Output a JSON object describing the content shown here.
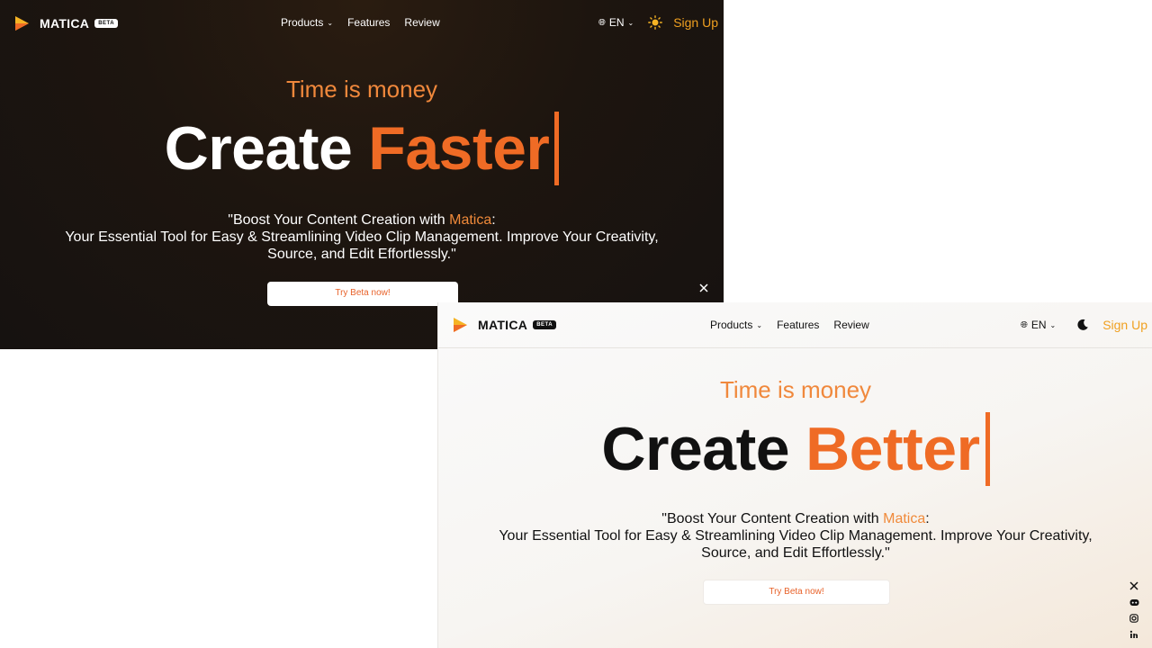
{
  "brand": {
    "name": "MATICA",
    "badge": "BETA"
  },
  "nav": {
    "products": "Products",
    "features": "Features",
    "review": "Review",
    "language": "EN",
    "signup": "Sign Up"
  },
  "hero": {
    "tagline": "Time is money",
    "headline_prefix": "Create",
    "description_open": "\"Boost Your Content Creation with ",
    "description_brand": "Matica",
    "description_colon": ":",
    "description_line2": "Your Essential Tool for Easy & Streamlining Video Clip Management. Improve Your Creativity,",
    "description_line3": "Source, and Edit Effortlessly.\"",
    "cta": "Try Beta now!"
  },
  "dark_view": {
    "headline_word": "Faster",
    "theme_toggle_icon": "sun-icon"
  },
  "light_view": {
    "headline_word": "Better",
    "theme_toggle_icon": "moon-icon"
  },
  "socials": [
    "x-icon",
    "discord-icon",
    "instagram-icon",
    "linkedin-icon"
  ],
  "colors": {
    "accent": "#ef6b25",
    "signup": "#f0a020",
    "dark_bg": "#1d150f",
    "light_bg": "#f7f5f2"
  }
}
